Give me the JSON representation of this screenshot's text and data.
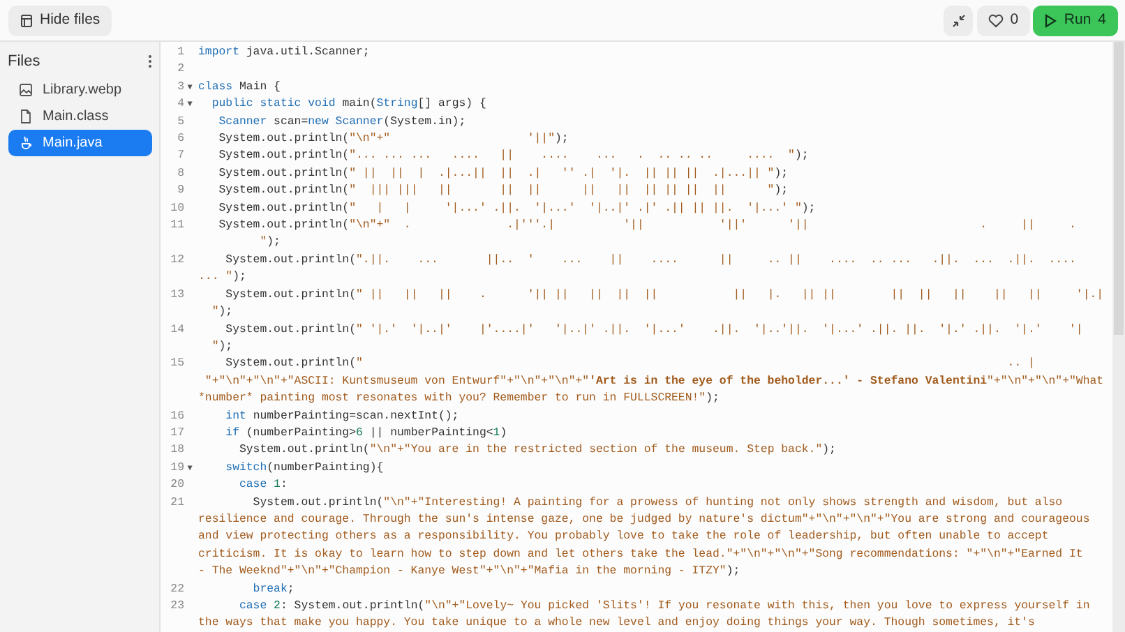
{
  "toolbar": {
    "hide_files": "Hide files",
    "likes": "0",
    "run": "Run",
    "run_count": "4"
  },
  "sidebar": {
    "title": "Files",
    "files": [
      {
        "name": "Library.webp",
        "kind": "image",
        "selected": false
      },
      {
        "name": "Main.class",
        "kind": "file",
        "selected": false
      },
      {
        "name": "Main.java",
        "kind": "java",
        "selected": true
      }
    ]
  },
  "editor": {
    "lines": [
      {
        "number": "1",
        "rows": [
          {
            "tokens": [
              {
                "kind": "keyword",
                "text": "import"
              },
              {
                "kind": "plain",
                "text": " java.util.Scanner;"
              }
            ]
          }
        ]
      },
      {
        "number": "2"
      },
      {
        "number": "3",
        "fold": "▼",
        "rows": [
          {
            "tokens": [
              {
                "kind": "keyword",
                "text": "class"
              },
              {
                "kind": "plain",
                "text": " Main {"
              }
            ]
          }
        ]
      },
      {
        "number": "4",
        "fold": "▼",
        "rows": [
          {
            "tokens": [
              {
                "kind": "keyword",
                "text": "  public static void"
              },
              {
                "kind": "plain",
                "text": " main("
              },
              {
                "kind": "keyword",
                "text": "String"
              },
              {
                "kind": "plain",
                "text": "[] args) {"
              }
            ]
          }
        ]
      },
      {
        "number": "5",
        "rows": [
          {
            "tokens": [
              {
                "kind": "keyword",
                "text": "   Scanner"
              },
              {
                "kind": "plain",
                "text": " scan="
              },
              {
                "kind": "keyword",
                "text": "new Scanner"
              },
              {
                "kind": "plain",
                "text": "(System.in);"
              }
            ]
          }
        ]
      },
      {
        "number": "6",
        "rows": [
          {
            "tokens": [
              {
                "kind": "plain",
                "text": "   System.out.println("
              },
              {
                "kind": "string",
                "text": "\"\\n\"+\"                    '||\""
              },
              {
                "kind": "plain",
                "text": ");"
              }
            ]
          }
        ]
      },
      {
        "number": "7",
        "rows": [
          {
            "tokens": [
              {
                "kind": "plain",
                "text": "   System.out.println("
              },
              {
                "kind": "string",
                "text": "\"... ... ...   ....   ||    ....    ...   .  .. .. ..     ....  \""
              },
              {
                "kind": "plain",
                "text": ");"
              }
            ]
          }
        ]
      },
      {
        "number": "8",
        "rows": [
          {
            "tokens": [
              {
                "kind": "plain",
                "text": "   System.out.println("
              },
              {
                "kind": "string",
                "text": "\" ||  ||  |  .|...||  ||  .|   '' .|  '|.  || || ||  .|...|| \""
              },
              {
                "kind": "plain",
                "text": ");"
              }
            ]
          }
        ]
      },
      {
        "number": "9",
        "rows": [
          {
            "tokens": [
              {
                "kind": "plain",
                "text": "   System.out.println("
              },
              {
                "kind": "string",
                "text": "\"  ||| |||   ||       ||  ||      ||   ||  || || ||  ||      \""
              },
              {
                "kind": "plain",
                "text": ");"
              }
            ]
          }
        ]
      },
      {
        "number": "10",
        "rows": [
          {
            "tokens": [
              {
                "kind": "plain",
                "text": "   System.out.println("
              },
              {
                "kind": "string",
                "text": "\"   |   |     '|...' .||.  '|...'  '|..|' .|' .|| || ||.  '|...' \""
              },
              {
                "kind": "plain",
                "text": ");"
              }
            ]
          }
        ]
      },
      {
        "number": "11",
        "rows": [
          {
            "tokens": [
              {
                "kind": "plain",
                "text": "   System.out.println("
              },
              {
                "kind": "string",
                "text": "\"\\n\"+\"  .              .|'''.|          '||           '||'      '||                         .     ||     ."
              }
            ]
          },
          {
            "tokens": [
              {
                "kind": "string",
                "text": "         \""
              },
              {
                "kind": "plain",
                "text": ");"
              }
            ]
          }
        ]
      },
      {
        "number": "12",
        "rows": [
          {
            "tokens": [
              {
                "kind": "plain",
                "text": "    System.out.println("
              },
              {
                "kind": "string",
                "text": "\".||.    ...       ||..  '    ...    ||    ....      ||     .. ||    ....  .. ...   .||.  ...  .||.  ...."
              }
            ]
          },
          {
            "tokens": [
              {
                "kind": "string",
                "text": "... \""
              },
              {
                "kind": "plain",
                "text": ");"
              }
            ]
          }
        ]
      },
      {
        "number": "13",
        "rows": [
          {
            "tokens": [
              {
                "kind": "plain",
                "text": "    System.out.println("
              },
              {
                "kind": "string",
                "text": "\" ||   ||   ||    .      '|| ||   ||  ||  ||           ||   |.   || ||        ||  ||   ||    ||   ||     '|.|"
              }
            ]
          },
          {
            "tokens": [
              {
                "kind": "string",
                "text": "  \""
              },
              {
                "kind": "plain",
                "text": ");"
              }
            ]
          }
        ]
      },
      {
        "number": "14",
        "rows": [
          {
            "tokens": [
              {
                "kind": "plain",
                "text": "    System.out.println("
              },
              {
                "kind": "string",
                "text": "\" '|.'  '|..|'    |'....|'   '|..|' .||.  '|...'    .||.  '|..'||.  '|...' .||. ||.  '|.' .||.  '|.'    '|"
              }
            ]
          },
          {
            "tokens": [
              {
                "kind": "string",
                "text": "  \""
              },
              {
                "kind": "plain",
                "text": ");"
              }
            ]
          }
        ]
      },
      {
        "number": "15",
        "rows": [
          {
            "tokens": [
              {
                "kind": "plain",
                "text": "    System.out.println("
              },
              {
                "kind": "string",
                "text": "\"                                                                                              .. |"
              }
            ]
          },
          {
            "tokens": [
              {
                "kind": "string",
                "text": " \"+\"\\n\"+\"\\n\"+\"ASCII: Kuntsmuseum von Entwurf\"+\"\\n\"+\"\\n\"+\""
              },
              {
                "kind": "bold",
                "text": "'Art is in the eye of the beholder...' - Stefano Valentini"
              },
              {
                "kind": "string",
                "text": "\"+\"\\n\"+\"\\n\"+\"What"
              }
            ]
          },
          {
            "tokens": [
              {
                "kind": "string",
                "text": "*number* painting most resonates with you? Remember to run in FULLSCREEN!\""
              },
              {
                "kind": "plain",
                "text": ");"
              }
            ]
          }
        ]
      },
      {
        "number": "16",
        "rows": [
          {
            "tokens": [
              {
                "kind": "keyword",
                "text": "    int"
              },
              {
                "kind": "plain",
                "text": " numberPainting=scan.nextInt();"
              }
            ]
          }
        ]
      },
      {
        "number": "17",
        "rows": [
          {
            "tokens": [
              {
                "kind": "keyword",
                "text": "    if"
              },
              {
                "kind": "plain",
                "text": " (numberPainting>"
              },
              {
                "kind": "number",
                "text": "6"
              },
              {
                "kind": "plain",
                "text": " || numberPainting<"
              },
              {
                "kind": "number",
                "text": "1"
              },
              {
                "kind": "plain",
                "text": ")"
              }
            ]
          }
        ]
      },
      {
        "number": "18",
        "rows": [
          {
            "tokens": [
              {
                "kind": "plain",
                "text": "      System.out.println("
              },
              {
                "kind": "string",
                "text": "\"\\n\"+\"You are in the restricted section of the museum. Step back.\""
              },
              {
                "kind": "plain",
                "text": ");"
              }
            ]
          }
        ]
      },
      {
        "number": "19",
        "fold": "▼",
        "rows": [
          {
            "tokens": [
              {
                "kind": "keyword",
                "text": "    switch"
              },
              {
                "kind": "plain",
                "text": "(numberPainting){"
              }
            ]
          }
        ]
      },
      {
        "number": "20",
        "rows": [
          {
            "tokens": [
              {
                "kind": "keyword",
                "text": "      case"
              },
              {
                "kind": "number",
                "text": " 1"
              },
              {
                "kind": "plain",
                "text": ":"
              }
            ]
          }
        ]
      },
      {
        "number": "21",
        "rows": [
          {
            "tokens": [
              {
                "kind": "plain",
                "text": "        System.out.println("
              },
              {
                "kind": "string",
                "text": "\"\\n\"+\"Interesting! A painting for a prowess of hunting not only shows strength and wisdom, but also"
              }
            ]
          },
          {
            "tokens": [
              {
                "kind": "string",
                "text": "resilience and courage. Through the sun's intense gaze, one be judged by nature's dictum\"+\"\\n\"+\"\\n\"+\"You are strong and courageous"
              }
            ]
          },
          {
            "tokens": [
              {
                "kind": "string",
                "text": "and view protecting others as a responsibility. You probably love to take the role of leadership, but often unable to accept"
              }
            ]
          },
          {
            "tokens": [
              {
                "kind": "string",
                "text": "criticism. It is okay to learn how to step down and let others take the lead.\"+\"\\n\"+\"\\n\"+\"Song recommendations: \"+\"\\n\"+\"Earned It"
              }
            ]
          },
          {
            "tokens": [
              {
                "kind": "string",
                "text": "- The Weeknd\"+\"\\n\"+\"Champion - Kanye West\"+\"\\n\"+\"Mafia in the morning - ITZY\""
              },
              {
                "kind": "plain",
                "text": ");"
              }
            ]
          }
        ]
      },
      {
        "number": "22",
        "rows": [
          {
            "tokens": [
              {
                "kind": "keyword",
                "text": "        break"
              },
              {
                "kind": "plain",
                "text": ";"
              }
            ]
          }
        ]
      },
      {
        "number": "23",
        "rows": [
          {
            "tokens": [
              {
                "kind": "keyword",
                "text": "      case"
              },
              {
                "kind": "number",
                "text": " 2"
              },
              {
                "kind": "plain",
                "text": ": System.out.println("
              },
              {
                "kind": "string",
                "text": "\"\\n\"+\"Lovely~ You picked 'Slits'! If you resonate with this, then you love to express yourself in"
              }
            ]
          },
          {
            "tokens": [
              {
                "kind": "string",
                "text": "the ways that make you happy. You take unique to a whole new level and enjoy doing things your way. Though sometimes, it's"
              }
            ]
          }
        ]
      }
    ]
  }
}
